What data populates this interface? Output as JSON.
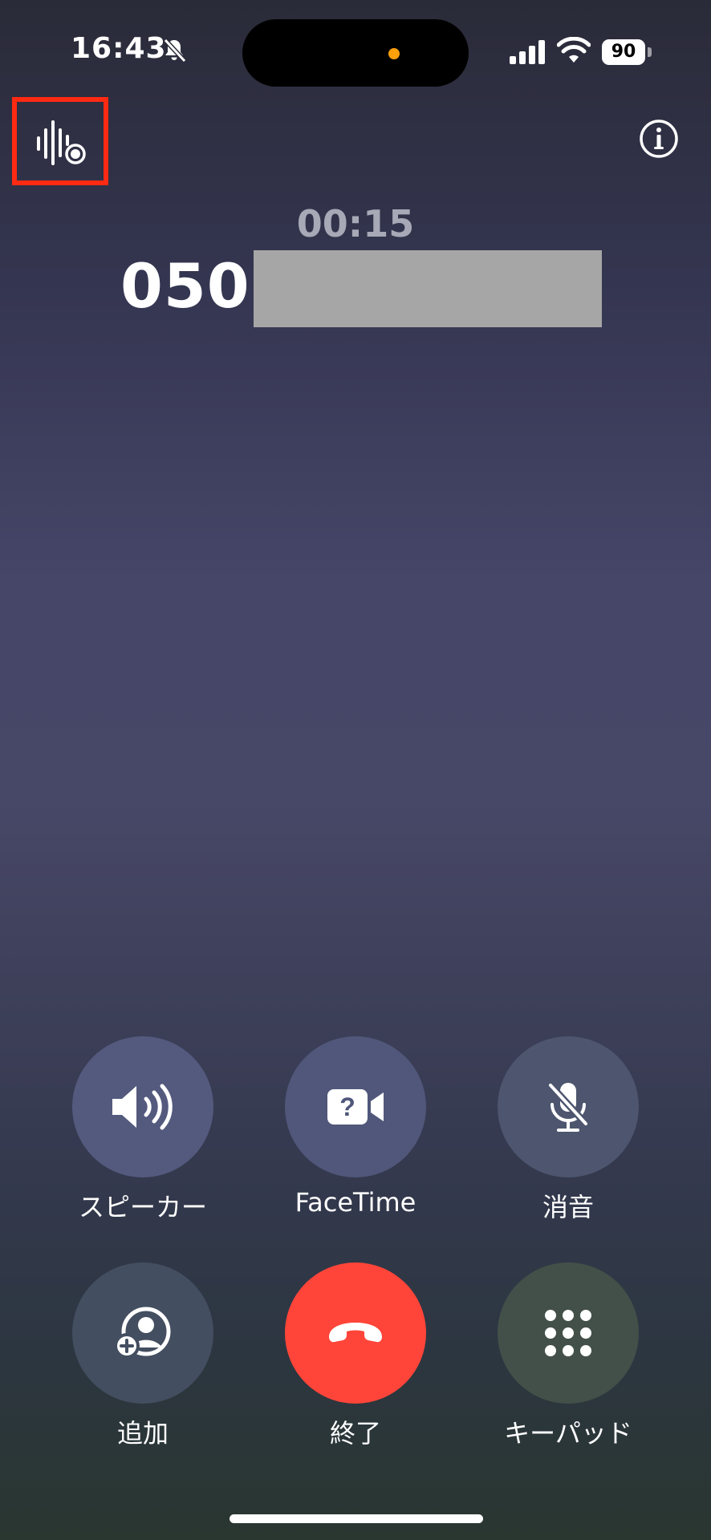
{
  "status_bar": {
    "time": "16:43",
    "battery": "90",
    "island_dot_color": "#ff9f0a"
  },
  "call": {
    "duration": "00:15",
    "number_prefix": "050"
  },
  "controls": [
    {
      "label": "スピーカー",
      "icon": "speaker-icon"
    },
    {
      "label": "FaceTime",
      "icon": "facetime-icon"
    },
    {
      "label": "消音",
      "icon": "mute-icon"
    },
    {
      "label": "追加",
      "icon": "add-call-icon"
    },
    {
      "label": "終了",
      "icon": "end-call-icon",
      "color": "#ff4539"
    },
    {
      "label": "キーパッド",
      "icon": "keypad-icon"
    }
  ],
  "colors": {
    "highlight": "#ff2a12",
    "end_call": "#ff4539"
  }
}
